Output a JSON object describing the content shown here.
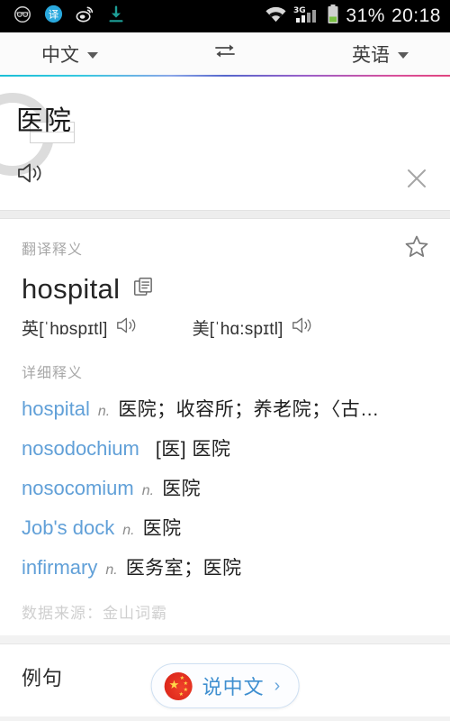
{
  "status_bar": {
    "icons": [
      "glasses-emoji-icon",
      "translate-app-icon",
      "weibo-icon",
      "download-icon"
    ],
    "wifi_icon": "wifi-icon",
    "network_type": "3G",
    "signal_icon": "signal-bars-icon",
    "battery_icon": "battery-icon",
    "battery_percent": "31%",
    "time": "20:18"
  },
  "language_bar": {
    "source_language": "中文",
    "target_language": "英语",
    "swap_icon": "swap-arrows-icon"
  },
  "search": {
    "query": "医院",
    "close_icon": "close-icon",
    "speaker_icon": "speaker-icon",
    "shutter_icon": "camera-shutter-icon"
  },
  "translation_card": {
    "header": "翻译释义",
    "star_icon": "star-outline-icon",
    "word": "hospital",
    "copy_icon": "copy-icon",
    "uk_phonetic": "英[ˈhɒspɪtl]",
    "uk_speaker_icon": "speaker-icon",
    "us_phonetic": "美[ˈhɑ:spɪtl]",
    "us_speaker_icon": "speaker-icon",
    "detail_header": "详细释义",
    "definitions": [
      {
        "term": "hospital",
        "pos": "n.",
        "meaning": "医院；收容所；养老院；〈古…"
      },
      {
        "term": "nosodochium",
        "pos": "",
        "meaning": "[医] 医院"
      },
      {
        "term": "nosocomium",
        "pos": "n.",
        "meaning": "医院"
      },
      {
        "term": "Job's dock",
        "pos": "n.",
        "meaning": "医院"
      },
      {
        "term": "infirmary",
        "pos": "n.",
        "meaning": "医务室；医院"
      }
    ],
    "source": "数据来源：金山词霸"
  },
  "examples_card": {
    "header": "例句"
  },
  "speak_button": {
    "flag_icon": "china-flag-icon",
    "label": "说中文",
    "chevron_icon": "chevron-right-icon"
  },
  "colors": {
    "accent_blue": "#61a0d8",
    "link_blue": "#3f8fd0",
    "status_bar_bg": "#000000",
    "muted_gray": "#a8a8a8"
  }
}
